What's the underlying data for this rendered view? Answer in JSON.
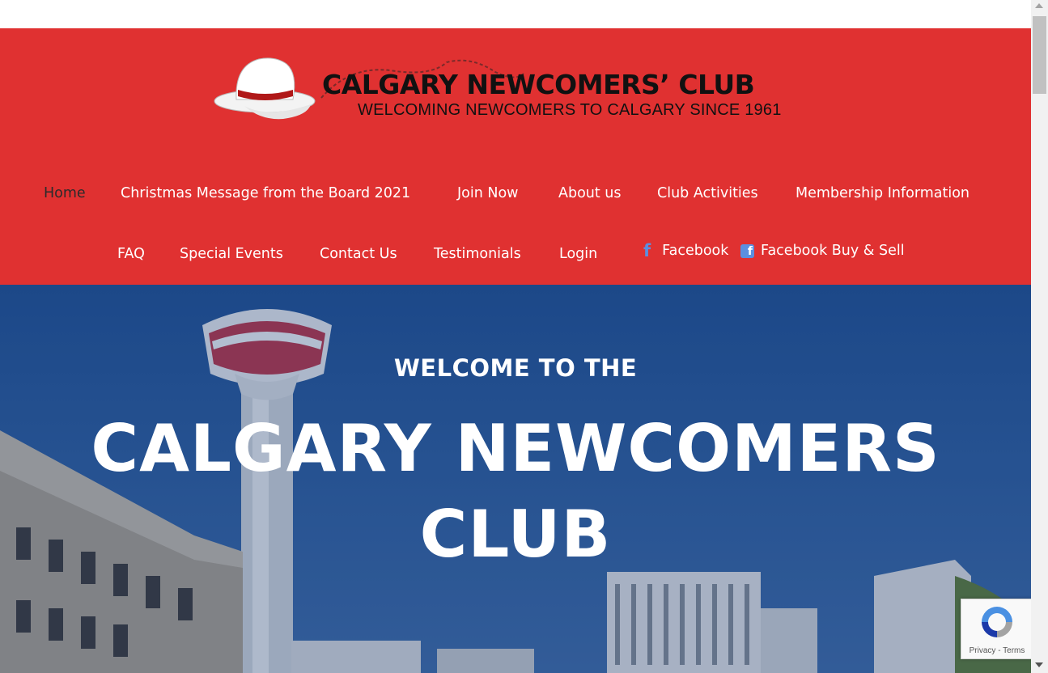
{
  "logo": {
    "title": "CALGARY NEWCOMERS’ CLUB",
    "subtitle": "WELCOMING NEWCOMERS TO CALGARY SINCE 1961"
  },
  "nav": {
    "items": [
      {
        "label": "Home",
        "active": true
      },
      {
        "label": "Christmas Message from the Board 2021"
      },
      {
        "label": "Join Now"
      },
      {
        "label": "About us"
      },
      {
        "label": "Club Activities"
      },
      {
        "label": "Membership Information"
      },
      {
        "label": "FAQ"
      },
      {
        "label": "Special Events"
      },
      {
        "label": "Contact Us"
      },
      {
        "label": "Testimonials"
      },
      {
        "label": "Login"
      }
    ],
    "facebook_label": "Facebook",
    "facebook_buysell_label": "Facebook Buy & Sell"
  },
  "hero": {
    "welcome": "WELCOME TO THE",
    "title_line1": "CALGARY NEWCOMERS",
    "title_line2": "CLUB"
  },
  "recaptcha": {
    "privacy": "Privacy",
    "terms": "Terms",
    "separator": " - "
  },
  "colors": {
    "header_red": "#e03131",
    "facebook_icon": "#5b8fe0",
    "hero_blue": "#2c5c9c"
  },
  "icons": [
    "cowboy-hat-logo",
    "facebook-f-icon",
    "facebook-square-icon",
    "recaptcha-icon",
    "calgary-tower-image"
  ]
}
